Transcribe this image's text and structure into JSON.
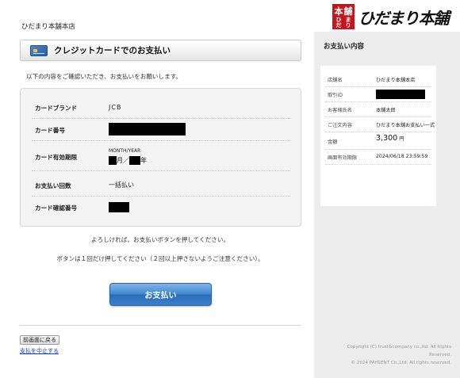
{
  "header": {
    "store_name": "ひだまり本舗本店",
    "logo_seal_chars": [
      "本",
      "舗",
      "ひだ",
      "まり"
    ],
    "logo_text": "ひだまり本舗",
    "seal_color": "#c4161c"
  },
  "title_bar": {
    "icon": "credit-card-icon",
    "title": "クレジットカードでのお支払い"
  },
  "intro_text": "以下の内容をご確認いただき、お支払いをお願いします。",
  "card_info": {
    "brand_label": "カードブランド",
    "brand_value": "JCB",
    "number_label": "カード番号",
    "number_value": "[redacted]",
    "expiry_label": "カード有効期限",
    "expiry_format": "MONTH/YEAR",
    "expiry_month_unit": "月",
    "expiry_sep": "／",
    "expiry_year_unit": "年",
    "payments_label": "お支払い回数",
    "payments_value": "一括払い",
    "cvv_label": "カード確認番号"
  },
  "confirm_text_1": "よろしければ、お支払いボタンを押してください。",
  "confirm_text_2": "ボタンは１回だけ押してください（２回以上押さないようご注意ください）。",
  "pay_button": "お支払い",
  "pay_button_color": "#3f86cf",
  "back_button": "前画面に戻る",
  "cancel_link": "支払を中止する",
  "sidebar": {
    "title": "お支払い内容",
    "rows": [
      {
        "key": "店舗名",
        "value": "ひだまり本舗本店"
      },
      {
        "key": "取引ID",
        "value": "[redacted]"
      },
      {
        "key": "お客様氏名",
        "value": "本舗太郎"
      },
      {
        "key": "ご注文内容",
        "value": "ひだまり本舗お支払い一式"
      },
      {
        "key": "金額",
        "value": "3,300",
        "unit": "円"
      },
      {
        "key": "画面有効期限",
        "value": "2024/06/18 23:59:59"
      }
    ],
    "copyright_1": "Copyright (C) trust&company co.,ltd. All Rights",
    "copyright_2": "Reserved.",
    "copyright_3": "© 2024 PAYGENT Co.,Ltd. All rights reserved."
  }
}
